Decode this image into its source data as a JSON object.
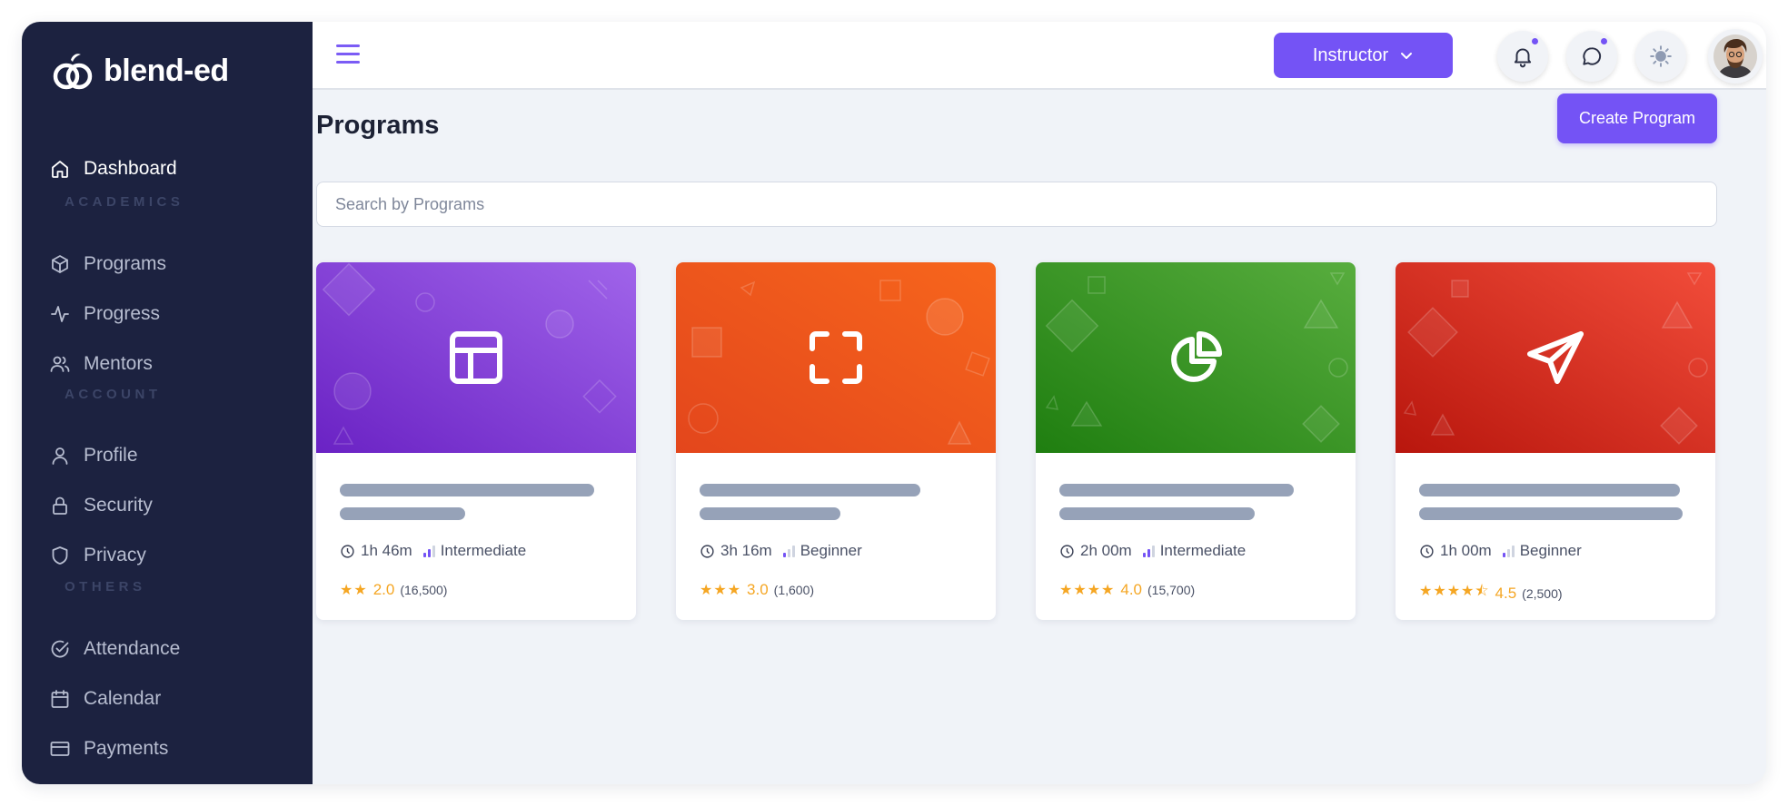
{
  "brand": {
    "name": "blend-ed"
  },
  "sidebar": {
    "dashboard": "Dashboard",
    "sections": {
      "academics": "ACADEMICS",
      "account": "ACCOUNT",
      "others": "OTHERS"
    },
    "items": {
      "programs": "Programs",
      "progress": "Progress",
      "mentors": "Mentors",
      "profile": "Profile",
      "security": "Security",
      "privacy": "Privacy",
      "attendance": "Attendance",
      "calendar": "Calendar",
      "payments": "Payments"
    }
  },
  "header": {
    "role": "Instructor",
    "notification_dot": true,
    "messages_dot": true
  },
  "main": {
    "title": "Programs",
    "create_button": "Create Program",
    "search_placeholder": "Search by Programs"
  },
  "cards": [
    {
      "icon": "layout-icon",
      "duration": "1h 46m",
      "level": "Intermediate",
      "rating": "2.0",
      "stars": "★★",
      "count": "(16,500)",
      "color_start": "#6a22c4",
      "color_end": "#a064ea"
    },
    {
      "icon": "frame-corners-icon",
      "duration": "3h 16m",
      "level": "Beginner",
      "rating": "3.0",
      "stars": "★★★",
      "count": "(1,600)",
      "color_start": "#e3461c",
      "color_end": "#f7661c"
    },
    {
      "icon": "pie-chart-icon",
      "duration": "2h 00m",
      "level": "Intermediate",
      "rating": "4.0",
      "stars": "★★★★",
      "count": "(15,700)",
      "color_start": "#1f7e10",
      "color_end": "#58ad3e"
    },
    {
      "icon": "send-icon",
      "duration": "1h 00m",
      "level": "Beginner",
      "rating": "4.5",
      "stars": "★★★★⯪",
      "count": "(2,500)",
      "color_start": "#b8160d",
      "color_end": "#f24d3a"
    }
  ],
  "colors": {
    "accent": "#7453f5",
    "sidebar_bg": "#1c2240",
    "star": "#f5a623"
  }
}
